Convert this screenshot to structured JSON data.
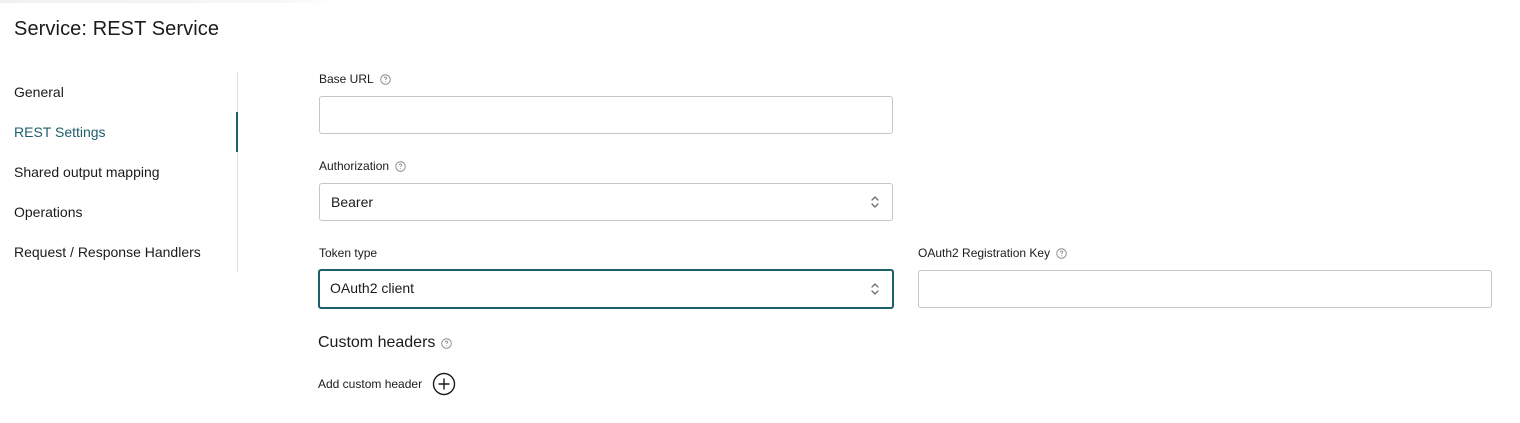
{
  "page": {
    "title": "Service: REST Service"
  },
  "sidebar": {
    "items": [
      {
        "label": "General",
        "active": false
      },
      {
        "label": "REST Settings",
        "active": true
      },
      {
        "label": "Shared output mapping",
        "active": false
      },
      {
        "label": "Operations",
        "active": false
      },
      {
        "label": "Request / Response Handlers",
        "active": false
      }
    ]
  },
  "form": {
    "base_url": {
      "label": "Base URL",
      "value": "",
      "help_icon": "question-circle-icon"
    },
    "authorization": {
      "label": "Authorization",
      "value": "Bearer",
      "help_icon": "question-circle-icon"
    },
    "token_type": {
      "label": "Token type",
      "value": "OAuth2 client"
    },
    "oauth2_key": {
      "label": "OAuth2 Registration Key",
      "value": "",
      "help_icon": "question-circle-icon"
    },
    "custom_headers": {
      "title": "Custom headers",
      "add_label": "Add custom header",
      "add_icon": "plus-circle-icon"
    }
  },
  "colors": {
    "accent": "#1f5f6b",
    "border": "#c6c6c6",
    "text": "#1b1b1b"
  }
}
